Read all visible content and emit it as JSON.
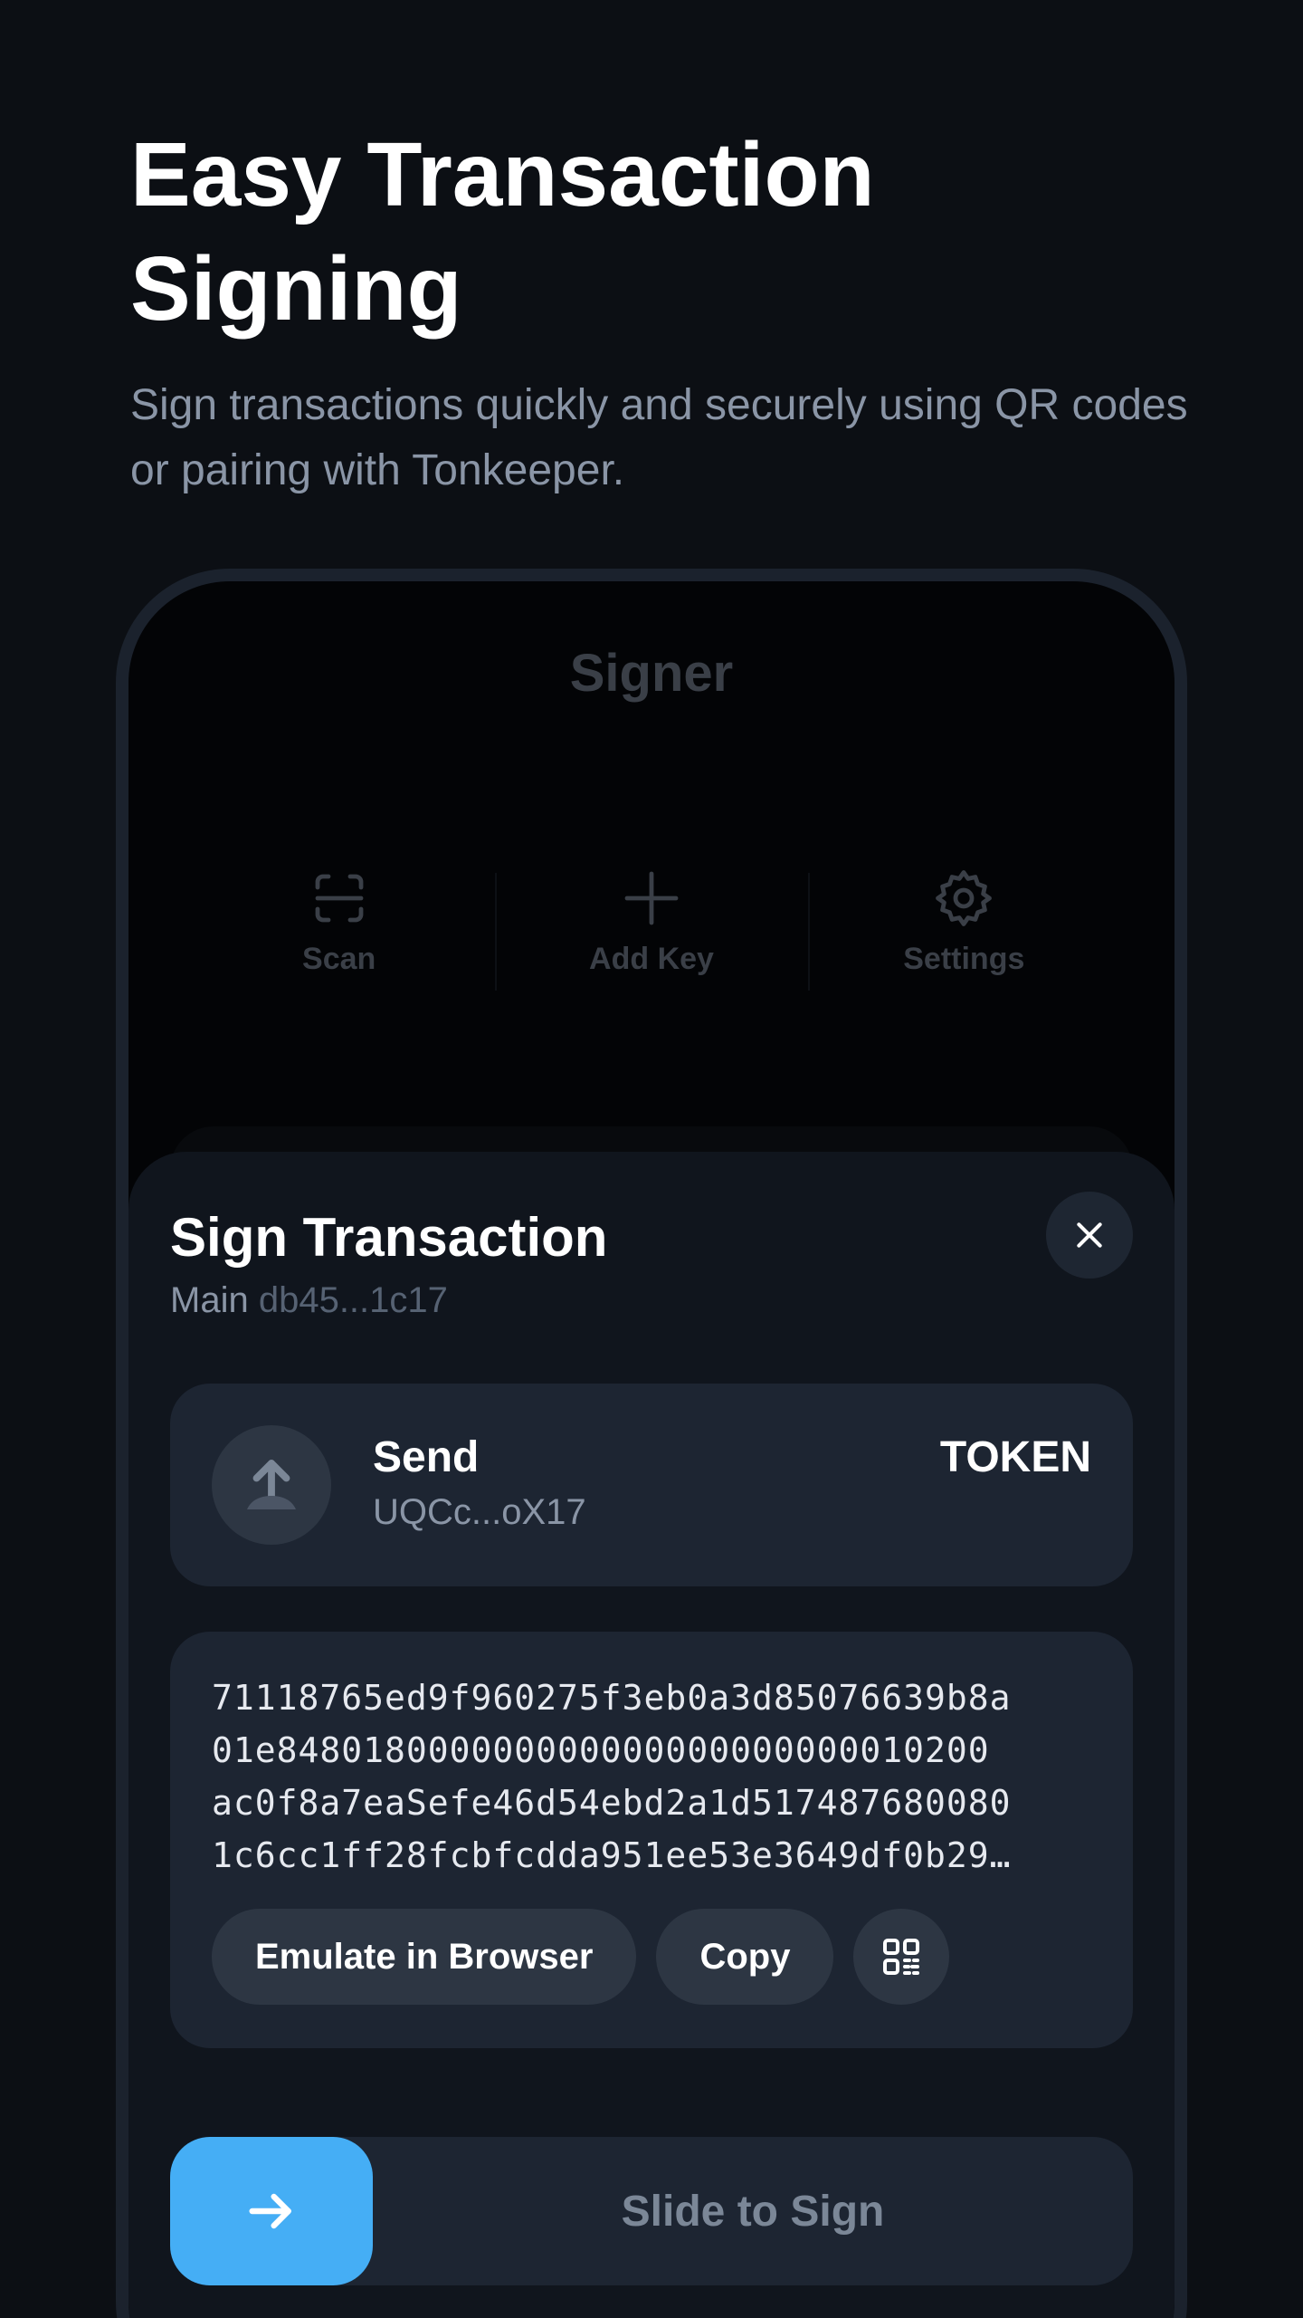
{
  "hero": {
    "title": "Easy Transaction Signing",
    "subtitle": "Sign transactions quickly and securely using QR codes or pairing with Tonkeeper."
  },
  "phone": {
    "title": "Signer",
    "actions": [
      {
        "label": "Scan",
        "icon": "scan-icon"
      },
      {
        "label": "Add Key",
        "icon": "plus-icon"
      },
      {
        "label": "Settings",
        "icon": "gear-icon"
      }
    ]
  },
  "sheet": {
    "title": "Sign Transaction",
    "wallet_name": "Main",
    "wallet_address": "db45...1c17",
    "close_icon": "close-icon",
    "transaction": {
      "kind": "Send",
      "address": "UQCc...oX17",
      "token": "TOKEN",
      "icon": "arrow-up-icon"
    },
    "payload_lines": [
      "71118765ed9f960275f3eb0a3d85076639b8a",
      "01e848018000000000000000000000010200",
      "ac0f8a7eaSefe46d54ebd2a1d517487680080",
      "1c6cc1ff28fcbfcdda951ee53e3649df0b29…"
    ],
    "buttons": {
      "emulate": "Emulate in Browser",
      "copy": "Copy",
      "qr_icon": "qr-code-icon"
    },
    "slider": {
      "label": "Slide to Sign",
      "icon": "arrow-right-icon"
    }
  },
  "colors": {
    "background": "#0c0f14",
    "sheet": "#10151d",
    "card": "#1d2532",
    "accent": "#45aef5"
  }
}
